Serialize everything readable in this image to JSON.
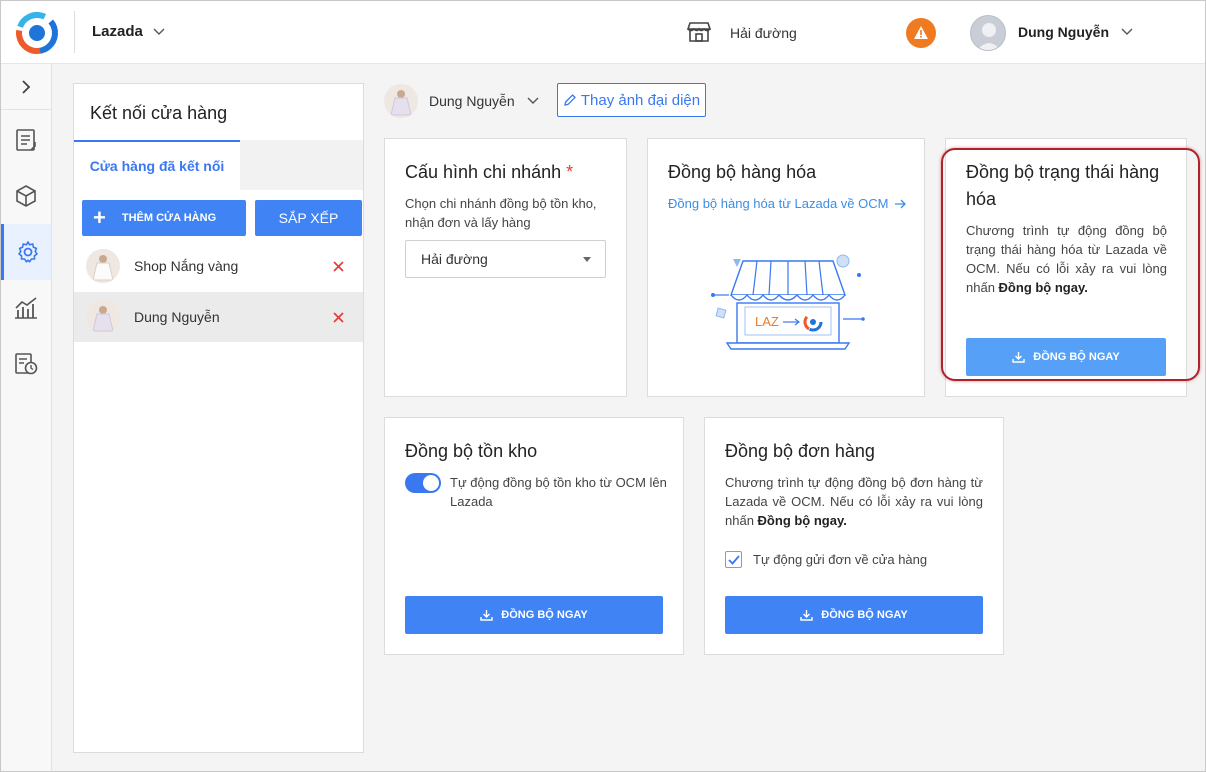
{
  "header": {
    "channel": "Lazada",
    "branch": "Hải đường",
    "user_name": "Dung Nguyễn"
  },
  "sidebar": {
    "items": [
      {
        "icon": "document-icon"
      },
      {
        "icon": "box-icon"
      },
      {
        "icon": "gear-icon"
      },
      {
        "icon": "chart-icon"
      },
      {
        "icon": "report-clock-icon"
      }
    ]
  },
  "store_panel": {
    "title": "Kết nối cửa hàng",
    "tab": "Cửa hàng đã kết nối",
    "add_button": "THÊM CỬA HÀNG",
    "sort_button": "SẮP XẾP",
    "stores": [
      {
        "name": "Shop Nắng vàng"
      },
      {
        "name": "Dung Nguyễn"
      }
    ]
  },
  "main": {
    "selected_store": "Dung Nguyễn",
    "change_avatar": "Thay ảnh đại diện"
  },
  "cards": {
    "branch_config": {
      "title": "Cấu hình chi nhánh",
      "required": "*",
      "desc": "Chọn chi nhánh đồng bộ tồn kho, nhận đơn và lấy hàng",
      "select_value": "Hải đường"
    },
    "product_sync": {
      "title": "Đồng bộ hàng hóa",
      "link": "Đồng bộ hàng hóa từ Lazada về OCM",
      "illus_text": "LAZ"
    },
    "status_sync": {
      "title": "Đồng bộ trạng thái hàng hóa",
      "desc": "Chương trình tự động đồng bộ trạng thái hàng hóa từ Lazada về OCM. Nếu có lỗi xảy ra vui lòng nhấn",
      "desc_bold": "Đồng bộ ngay.",
      "button": "ĐỒNG BỘ NGAY"
    },
    "stock_sync": {
      "title": "Đồng bộ tồn kho",
      "toggle_label": "Tự động đồng bộ tồn kho từ OCM lên Lazada",
      "toggle_on": true,
      "button": "ĐỒNG BỘ NGAY"
    },
    "order_sync": {
      "title": "Đồng bộ đơn hàng",
      "desc": "Chương trình tự động đồng bộ đơn hàng từ Lazada về OCM. Nếu có lỗi xảy ra vui lòng nhấn",
      "desc_bold": "Đồng bộ ngay.",
      "checkbox_label": "Tự động gửi đơn về cửa hàng",
      "checked": true,
      "button": "ĐỒNG BỘ NGAY"
    }
  },
  "colors": {
    "primary": "#3f83f5",
    "primary_light": "#56a0f8",
    "danger": "#e53935",
    "warning": "#f07a20",
    "highlight": "#b0222a"
  }
}
